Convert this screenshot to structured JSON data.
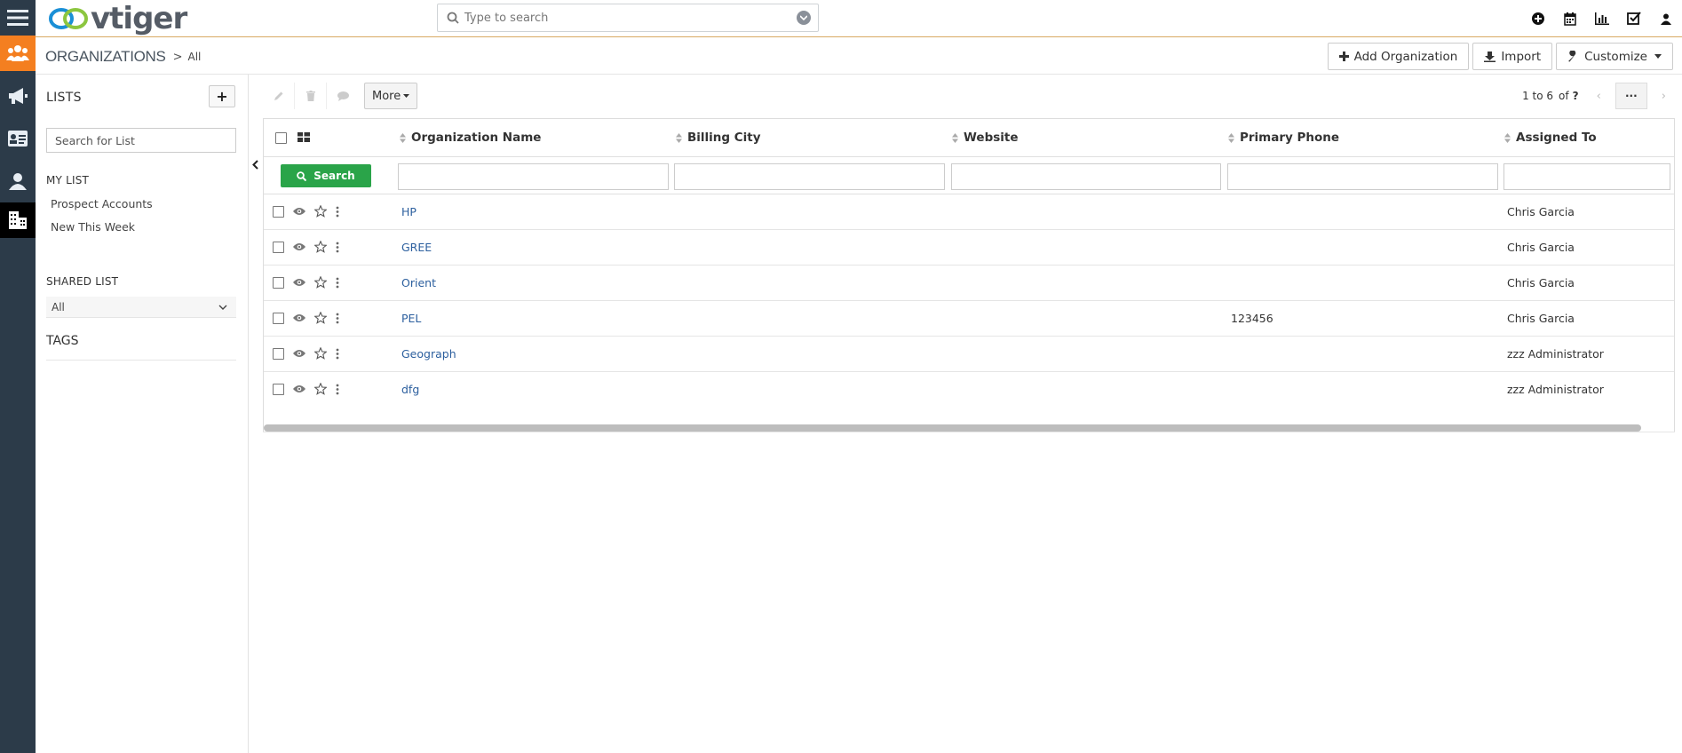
{
  "app": {
    "logo_text": "vtiger",
    "search_placeholder": "Type to search"
  },
  "rail": {
    "items": [
      {
        "icon": "menu-icon"
      },
      {
        "icon": "contacts-group-icon"
      },
      {
        "icon": "megaphone-icon"
      },
      {
        "icon": "contact-card-icon"
      },
      {
        "icon": "user-icon"
      },
      {
        "icon": "organization-building-icon"
      }
    ]
  },
  "header_icons": [
    "plus-circle-icon",
    "calendar-icon",
    "bar-chart-icon",
    "checkbox-icon",
    "user-icon"
  ],
  "breadcrumb": {
    "module": "ORGANIZATIONS",
    "separator": ">",
    "view": "All"
  },
  "actions": {
    "add": "Add Organization",
    "import": "Import",
    "customize": "Customize"
  },
  "sidebar": {
    "lists_title": "LISTS",
    "add_label": "+",
    "search_placeholder": "Search for List",
    "my_list_title": "MY LIST",
    "my_list_items": [
      "Prospect Accounts",
      "New This Week"
    ],
    "shared_list_title": "SHARED LIST",
    "shared_list_selected": "All",
    "tags_title": "TAGS"
  },
  "toolbar": {
    "more_label": "More"
  },
  "pager": {
    "range": "1 to 6",
    "of_label": "of",
    "total": "?",
    "dots": "···"
  },
  "table": {
    "search_button": "Search",
    "columns": [
      "Organization Name",
      "Billing City",
      "Website",
      "Primary Phone",
      "Assigned To"
    ],
    "rows": [
      {
        "name": "HP",
        "city": "",
        "website": "",
        "phone": "",
        "assigned": "Chris Garcia"
      },
      {
        "name": "GREE",
        "city": "",
        "website": "",
        "phone": "",
        "assigned": "Chris Garcia"
      },
      {
        "name": "Orient",
        "city": "",
        "website": "",
        "phone": "",
        "assigned": "Chris Garcia"
      },
      {
        "name": "PEL",
        "city": "",
        "website": "",
        "phone": "123456",
        "assigned": "Chris Garcia"
      },
      {
        "name": "Geograph",
        "city": "",
        "website": "",
        "phone": "",
        "assigned": "zzz Administrator"
      },
      {
        "name": "dfg",
        "city": "",
        "website": "",
        "phone": "",
        "assigned": "zzz Administrator"
      }
    ]
  },
  "colors": {
    "rail_bg": "#2c3b49",
    "rail_active": "#f47f20",
    "search_green": "#2aa449",
    "link_blue": "#2c5f9e"
  }
}
